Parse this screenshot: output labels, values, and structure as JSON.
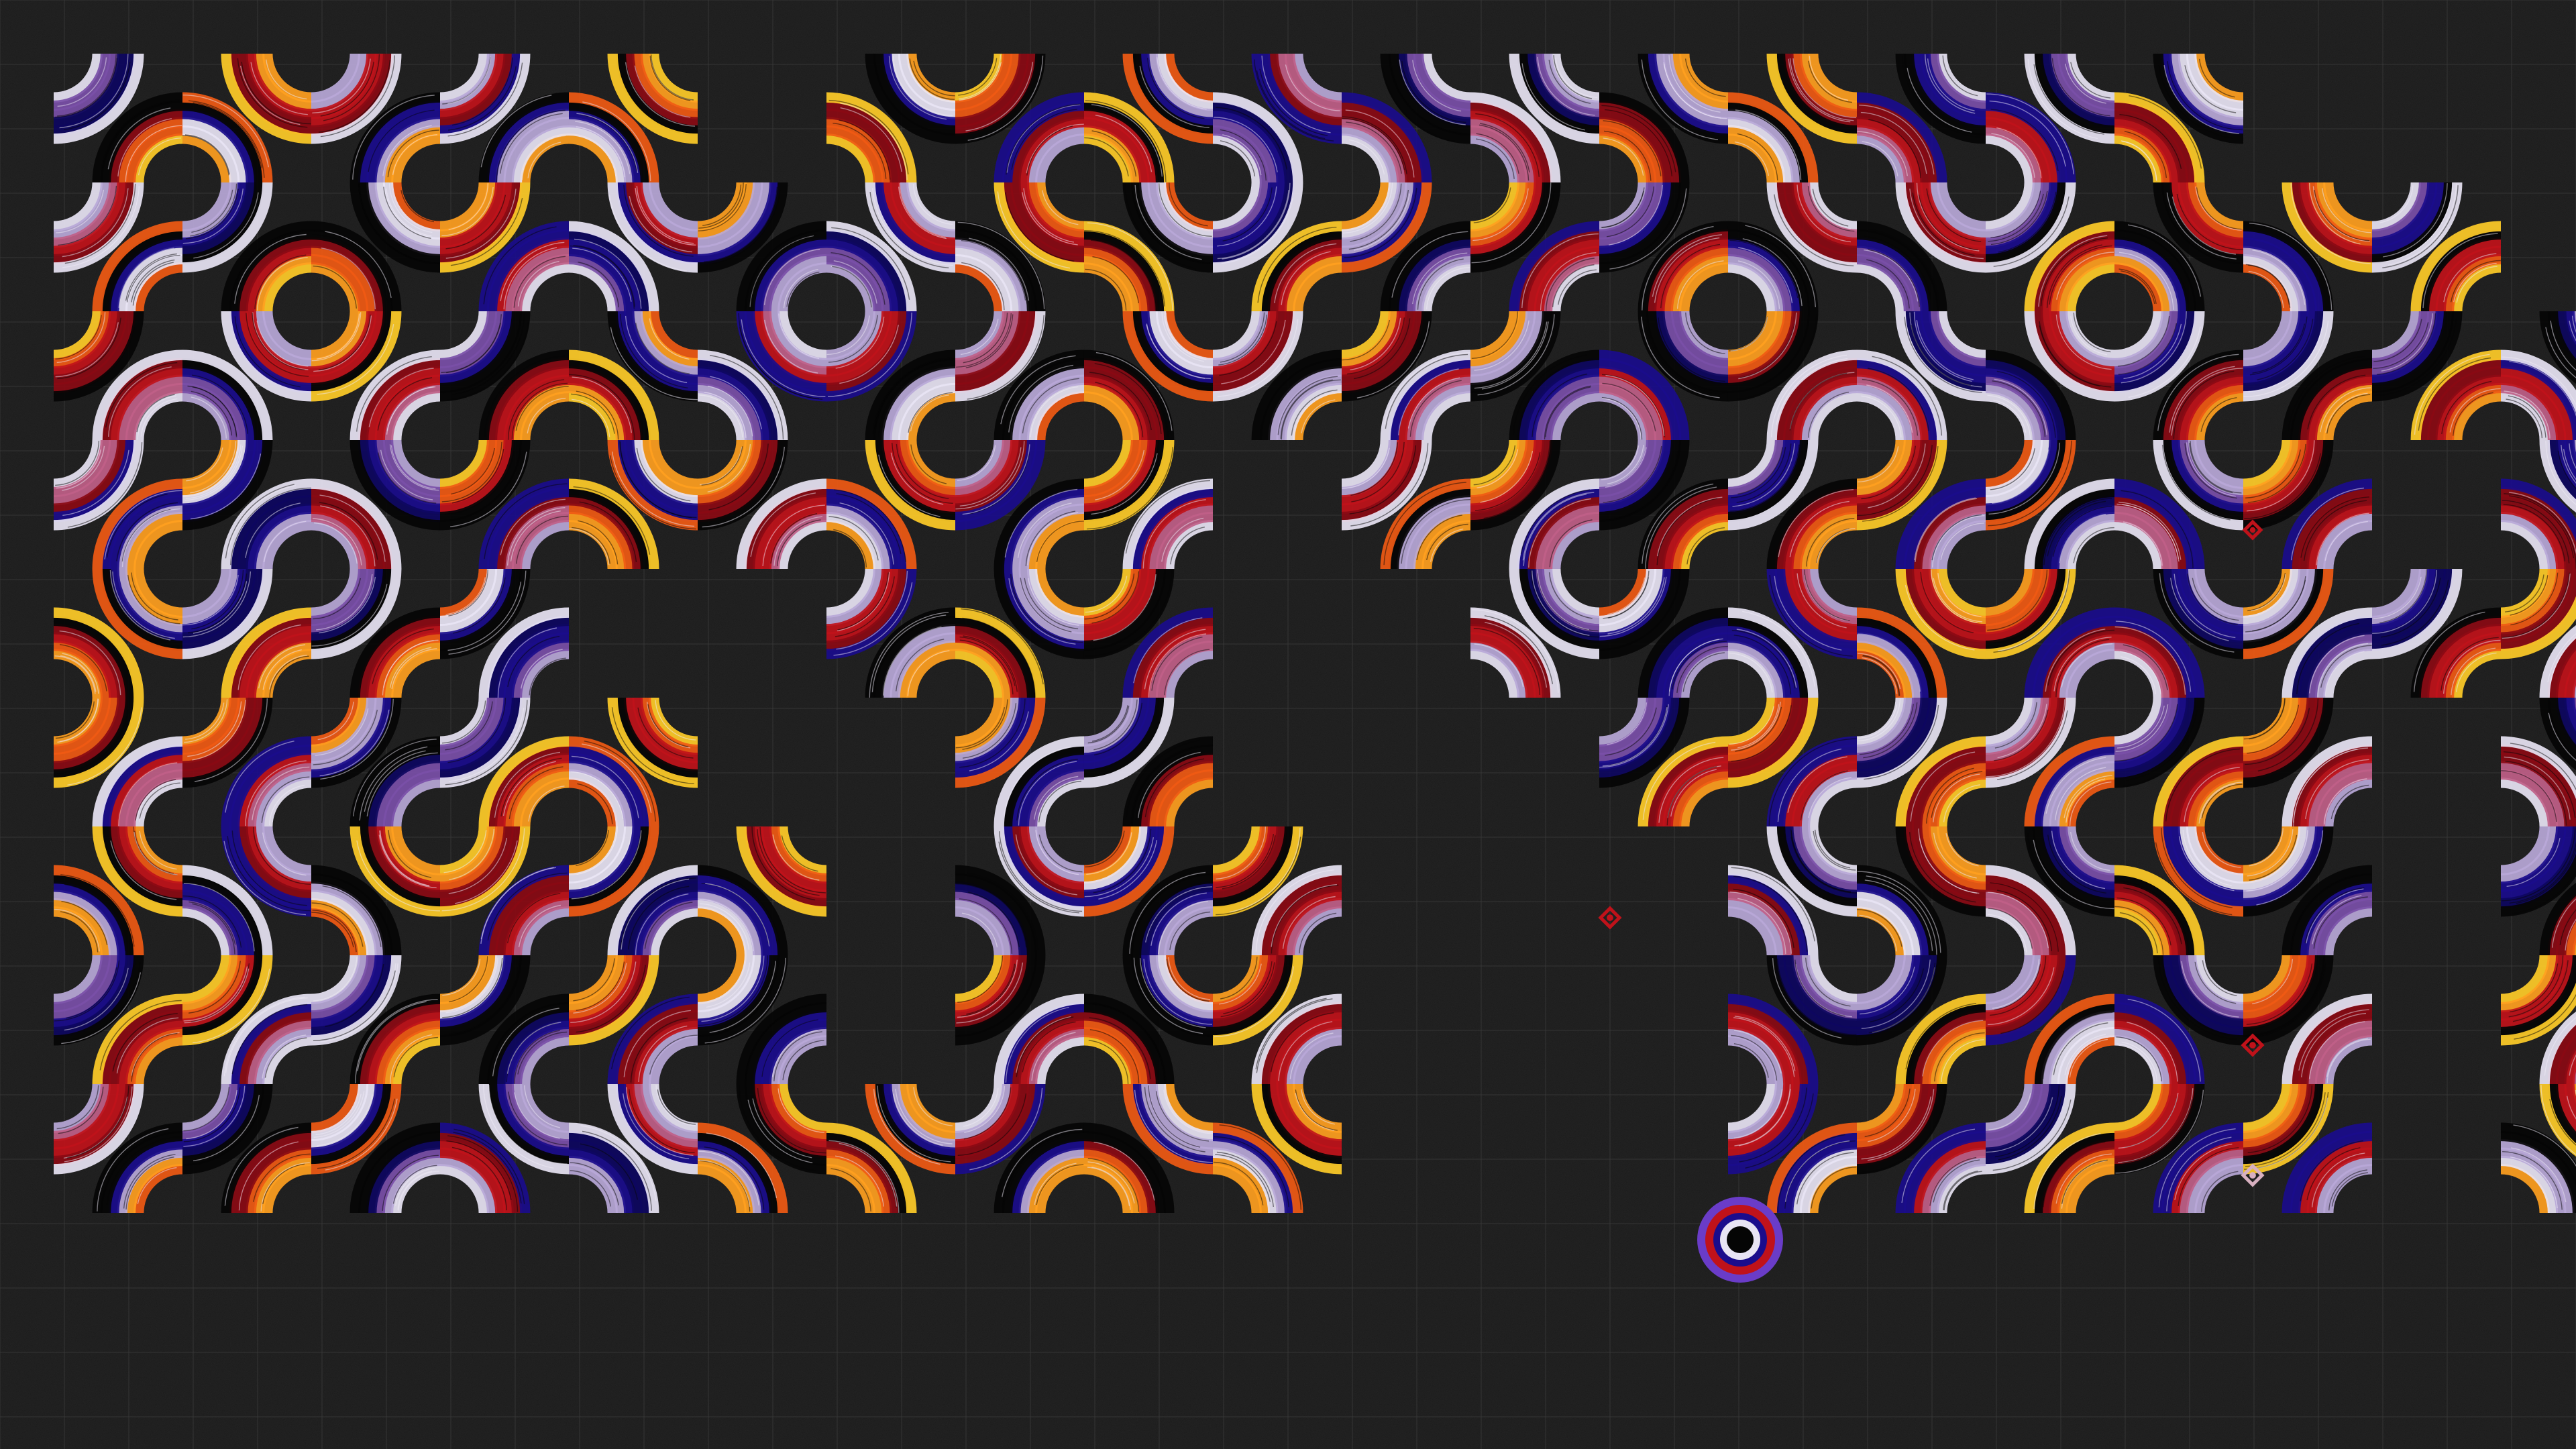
{
  "artwork": {
    "description_free": true,
    "grid_cols": 20,
    "grid_rows": 11,
    "palette": {
      "background": "#1b1b1b",
      "grid_line": "#3a3a3a",
      "white": "#d8d4e4",
      "lavender": "#b8a8d8",
      "violet": "#7a4fa8",
      "indigo": "#1a0c8c",
      "deep_indigo": "#0d0660",
      "black": "#050505",
      "red": "#c0121a",
      "crimson": "#8a0a14",
      "orange": "#f05a14",
      "amber": "#ffa020",
      "yellow": "#ffcc28"
    },
    "stripe_palettes": [
      [
        "#e8e4f4",
        "#b8a8d8",
        "#7a4fa8",
        "#1a0c8c",
        "#0d0660",
        "#050505"
      ],
      [
        "#ffcc28",
        "#ffa020",
        "#f05a14",
        "#c0121a",
        "#8a0a14",
        "#050505"
      ],
      [
        "#e8e4f4",
        "#b8a8d8",
        "#c06088",
        "#c0121a",
        "#8a0a14",
        "#1a0c8c"
      ],
      [
        "#f05a14",
        "#ffa020",
        "#e8e4f4",
        "#b8a8d8",
        "#1a0c8c",
        "#050505"
      ]
    ],
    "markers": [
      {
        "name": "diamond-red",
        "color": "#c0121a"
      },
      {
        "name": "diamond-pale",
        "color": "#d8b0c0"
      },
      {
        "name": "target",
        "colors": [
          "#6a3cc8",
          "#c0121a",
          "#1a0c8c",
          "#e8e4f4",
          "#050505"
        ]
      }
    ]
  }
}
